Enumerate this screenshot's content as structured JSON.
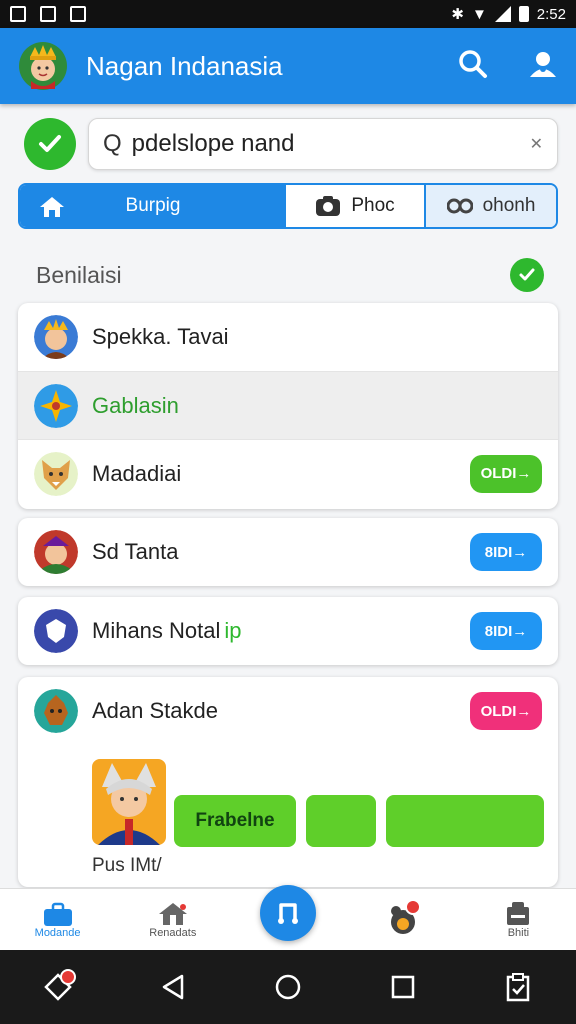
{
  "status_bar": {
    "time": "2:52"
  },
  "app_bar": {
    "title": "Nagan Indanasia",
    "logo_icon": "crowned-hero-logo",
    "search_icon": "search-icon",
    "account_icon": "account-icon"
  },
  "search": {
    "value": "pdelslope nand",
    "prefix": "Q"
  },
  "tabs": [
    {
      "label": "Burpig",
      "icon": "home-icon"
    },
    {
      "label": "Phoc",
      "icon": "camera-icon"
    },
    {
      "label": "ohonh",
      "icon": "link-icon"
    }
  ],
  "section": {
    "title": "Benilaisi"
  },
  "list_group": [
    {
      "label": "Spekka. Tavai"
    },
    {
      "label": "Gablasin"
    },
    {
      "label": "Madadiai",
      "pill": "OLDI→"
    }
  ],
  "cards": [
    {
      "label": "Sd Tanta",
      "pill": "8IDI→"
    },
    {
      "label": "Mihans Notal",
      "tag": "ip",
      "pill": "8IDI→"
    },
    {
      "label": "Adan Stakde",
      "pill": "OLDI→"
    }
  ],
  "big_card": {
    "button_label": "Frabelne",
    "caption": "Pus IMt/"
  },
  "bottom_nav": [
    {
      "label": "Modande"
    },
    {
      "label": "Renadats"
    },
    {
      "label": ""
    },
    {
      "label": ""
    },
    {
      "label": "Bhiti"
    }
  ],
  "colors": {
    "primary": "#1e88e5",
    "green": "#2eb82e",
    "pink": "#f0307a"
  }
}
